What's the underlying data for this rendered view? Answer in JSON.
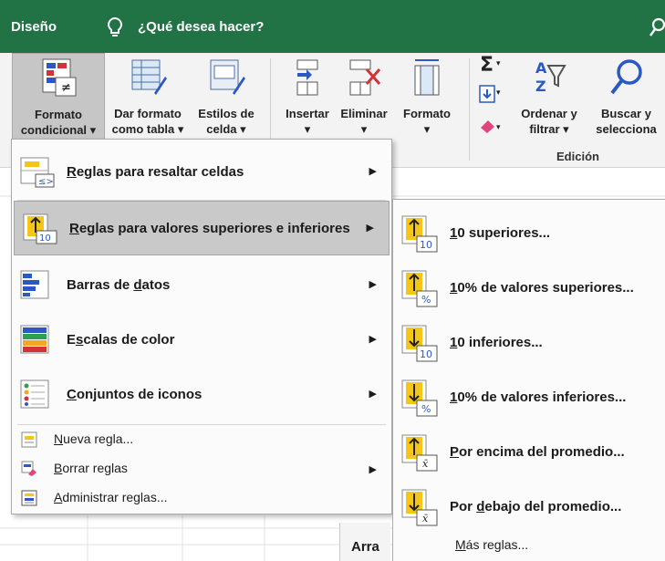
{
  "titlebar": {
    "tab": "Diseño",
    "tell_me": "¿Qué desea hacer?"
  },
  "ribbon": {
    "conditional_format": {
      "line1": "Formato",
      "line2": "condicional ▾"
    },
    "format_table": {
      "line1": "Dar formato",
      "line2": "como tabla ▾"
    },
    "cell_styles": {
      "line1": "Estilos de",
      "line2": "celda ▾"
    },
    "insert": {
      "line1": "Insertar",
      "line2": "▾"
    },
    "delete": {
      "line1": "Eliminar",
      "line2": "▾"
    },
    "format": {
      "line1": "Formato",
      "line2": "▾"
    },
    "sort_filter": {
      "line1": "Ordenar y",
      "line2": "filtrar ▾"
    },
    "find_select": {
      "line1": "Buscar y",
      "line2": "selecciona"
    },
    "editing_group": "Edición",
    "colors": {
      "green": "#217346",
      "yellow": "#f5c518",
      "blue": "#2b59c3",
      "red": "#d13438"
    }
  },
  "menu": {
    "items": [
      {
        "icon": "highlight-cells-icon",
        "pre": "",
        "key": "R",
        "post": "eglas para resaltar celdas"
      },
      {
        "icon": "top-bottom-rules-icon",
        "pre": "",
        "key": "R",
        "post": "eglas para valores superiores e inferiores"
      },
      {
        "icon": "data-bars-icon",
        "pre": "Barras de ",
        "key": "d",
        "post": "atos"
      },
      {
        "icon": "color-scales-icon",
        "pre": "E",
        "key": "s",
        "post": "calas de color"
      },
      {
        "icon": "icon-sets-icon",
        "pre": "",
        "key": "C",
        "post": "onjuntos de iconos"
      },
      {
        "icon": "new-rule-icon",
        "pre": "",
        "key": "N",
        "post": "ueva regla..."
      },
      {
        "icon": "clear-rules-icon",
        "pre": "",
        "key": "B",
        "post": "orrar reglas"
      },
      {
        "icon": "manage-rules-icon",
        "pre": "",
        "key": "A",
        "post": "dministrar reglas..."
      }
    ]
  },
  "submenu": {
    "items": [
      {
        "icon": "top-10-icon",
        "badge": "10",
        "pre": "",
        "key": "1",
        "post": "0 superiores..."
      },
      {
        "icon": "top-10-percent-icon",
        "badge": "%",
        "pre": "",
        "key": "1",
        "post": "0% de valores superiores..."
      },
      {
        "icon": "bottom-10-icon",
        "badge": "10",
        "pre": "",
        "key": "1",
        "post": "0 inferiores..."
      },
      {
        "icon": "bottom-10-percent-icon",
        "badge": "%",
        "pre": "",
        "key": "1",
        "post": "0% de valores inferiores..."
      },
      {
        "icon": "above-average-icon",
        "badge": "x̄",
        "pre": "",
        "key": "P",
        "post": "or encima del promedio..."
      },
      {
        "icon": "below-average-icon",
        "badge": "x̄",
        "pre": "Por ",
        "key": "d",
        "post": "ebajo del promedio..."
      }
    ],
    "more_rules": {
      "pre": "",
      "key": "M",
      "post": "ás reglas..."
    }
  },
  "sheet": {
    "tab_partial": "Arra"
  }
}
